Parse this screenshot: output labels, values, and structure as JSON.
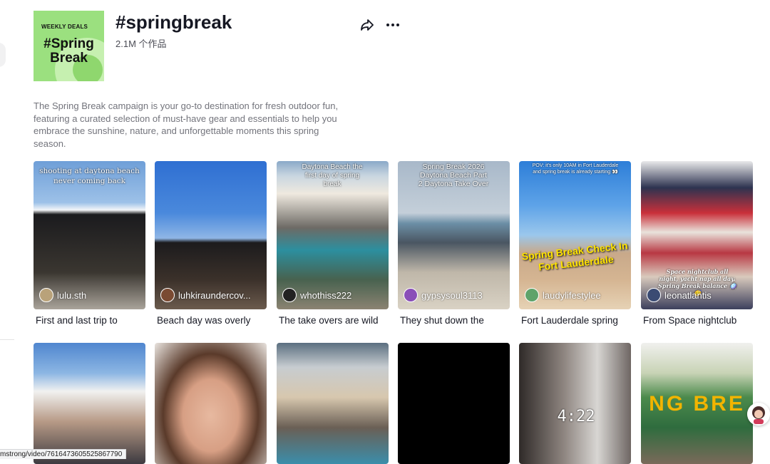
{
  "header": {
    "cover": {
      "tag": "WEEKLY DEALS",
      "line1": "#Spring",
      "line2": "Break"
    },
    "title": "#springbreak",
    "count": "2.1M 个作品",
    "share_icon": "share-icon",
    "more_icon": "more-icon"
  },
  "description": "The Spring Break campaign is your go-to destination for fresh outdoor fun, featuring a curated selection of must-have gear and essentials to help you embrace the sunshine, nature, and unforgettable moments this spring season.",
  "videos": [
    {
      "handle": "lulu.sth",
      "caption": "First and last trip to",
      "overlay": "shooting at daytona beach never coming back"
    },
    {
      "handle": "luhkiraundercov...",
      "caption": "Beach day was overly",
      "overlay": ""
    },
    {
      "handle": "whothiss222",
      "caption": "The take overs are wild",
      "overlay": "Daytona Beach the first day of spring break"
    },
    {
      "handle": "gypsysoul3113",
      "caption": "They shut down the",
      "overlay": "Spring Break 2026 Daytona Beach Part 2 Daytona Take Over"
    },
    {
      "handle": "laudylifestylee",
      "caption": "Fort Lauderdale spring",
      "overlay": "POV: it's only 10AM in Fort Lauderdale and spring break is already starting 👀",
      "overlay2": "Spring Break Check In Fort Lauderdale"
    },
    {
      "handle": "leonatlantis",
      "caption": "From Space nightclub",
      "overlay": "Space nightclub all night, yacht nap all day. Spring Break balance 🪩😴"
    }
  ],
  "row2": [
    {
      "overlay": ""
    },
    {
      "overlay": ""
    },
    {
      "overlay": ""
    },
    {
      "overlay": ""
    },
    {
      "overlay": "4:22"
    },
    {
      "overlay": "NG BRE"
    }
  ],
  "status_url": "mstrong/video/7616473605525867790",
  "colors": {
    "cover_green": "#9be07f",
    "text_primary": "#161823",
    "text_secondary": "#73747c"
  }
}
